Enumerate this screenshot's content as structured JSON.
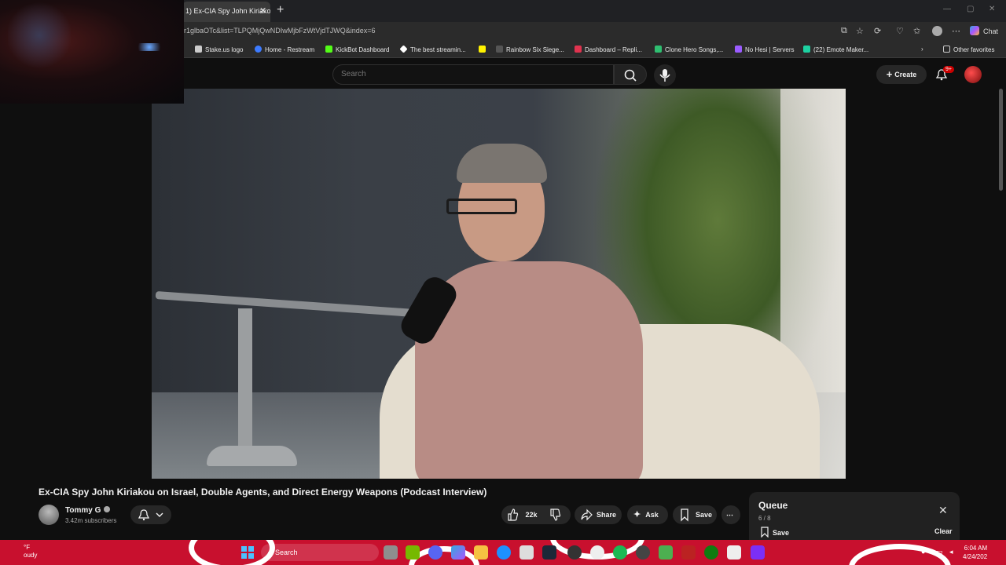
{
  "browser": {
    "active_tab_title": "1) Ex-CIA Spy John Kiriako",
    "url": "r1glbaOTc&list=TLPQMjQwNDIwMjbFzWtVjdTJWQ&index=6",
    "chat_label": "Chat",
    "bookmarks": [
      {
        "label": "Stake.us logo",
        "color": "#e8e8e8"
      },
      {
        "label": "Home - Restream",
        "color": "#3d7bff"
      },
      {
        "label": "KickBot Dashboard",
        "color": "#53fc18"
      },
      {
        "label": "The best streamin...",
        "color": "#ffffff"
      },
      {
        "label": "",
        "color": "#fff200"
      },
      {
        "label": "Rainbow Six Siege...",
        "color": "#bbbbbb"
      },
      {
        "label": "Dashboard – Repli...",
        "color": "#e0334f"
      },
      {
        "label": "Clone Hero Songs,...",
        "color": "#2fbf71"
      },
      {
        "label": "No Hesi | Servers",
        "color": "#9b5cff"
      },
      {
        "label": "(22) Emote Maker...",
        "color": "#1dd1a1"
      }
    ],
    "other_favorites": "Other favorites"
  },
  "youtube": {
    "search_placeholder": "Search",
    "create_label": "Create",
    "notification_badge": "9+",
    "video_title": "Ex-CIA Spy John Kiriakou on Israel, Double Agents, and Direct Energy Weapons (Podcast Interview)",
    "channel_name": "Tommy G",
    "subscribers": "3.42m subscribers",
    "likes": "22k",
    "share_label": "Share",
    "ask_label": "Ask",
    "save_label": "Save",
    "queue": {
      "title": "Queue",
      "count": "6 / 8",
      "save_label": "Save",
      "clear_label": "Clear"
    }
  },
  "taskbar": {
    "weather_temp": "°F",
    "weather_desc": "oudy",
    "search_label": "Search",
    "time": "6:04 AM",
    "date": "4/24/202"
  },
  "icons": {
    "accent_red": "#c8102e",
    "youtube_bg": "#0f0f0f"
  }
}
